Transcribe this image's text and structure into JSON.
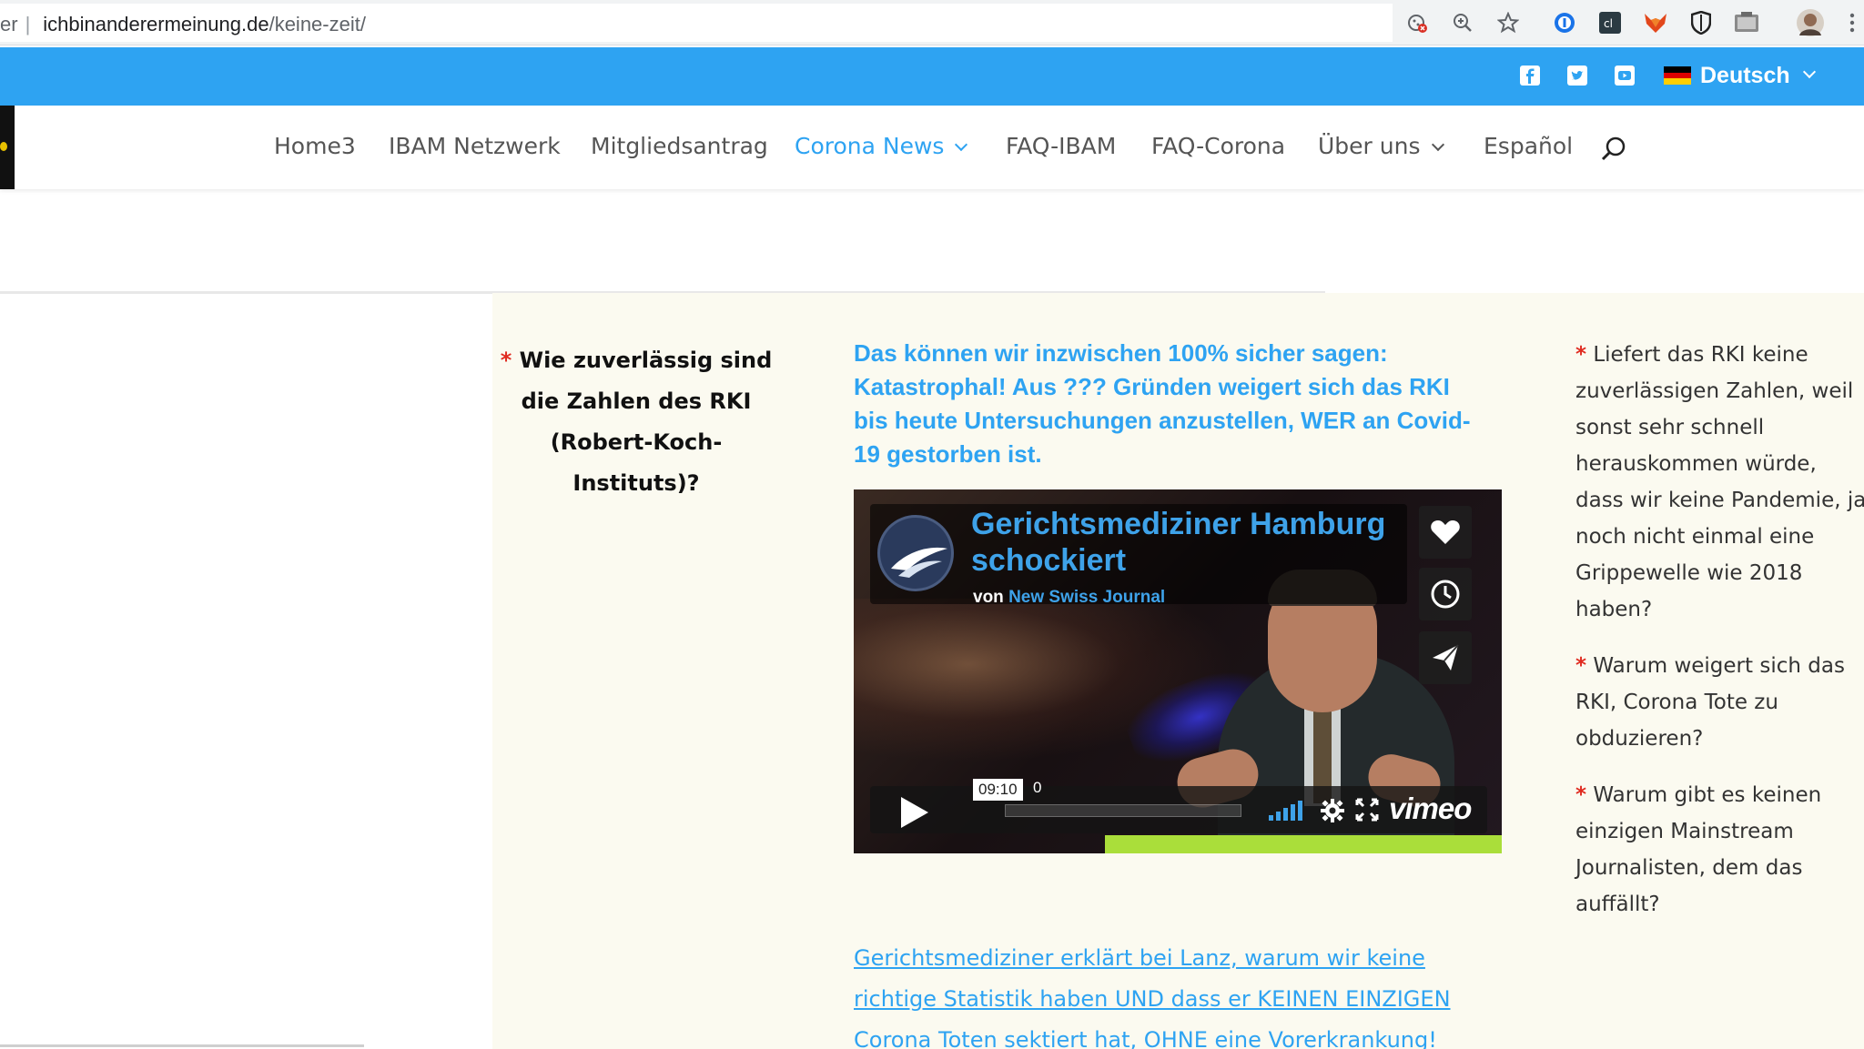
{
  "browser": {
    "prev_fragment": "er",
    "url_domain": "ichbinanderermeinung.de",
    "url_path": "/keine-zeit/"
  },
  "topbar": {
    "language": "Deutsch",
    "social_icons": [
      "facebook-icon",
      "twitter-icon",
      "youtube-icon"
    ]
  },
  "nav": {
    "items": [
      {
        "label": "Home3"
      },
      {
        "label": "IBAM Netzwerk"
      },
      {
        "label": "Mitgliedsantrag"
      },
      {
        "label": "Corona News",
        "active": true,
        "dropdown": true
      },
      {
        "label": "FAQ-IBAM"
      },
      {
        "label": "FAQ-Corona"
      },
      {
        "label": "Über uns",
        "dropdown": true
      },
      {
        "label": "Español"
      }
    ]
  },
  "left_question": {
    "asterisk": "*",
    "text": "Wie zuverlässig sind die Zahlen des RKI (Robert-Koch-Instituts)?"
  },
  "main": {
    "headline": "Das können wir inzwischen 100% sicher sagen: Katastrophal! Aus ??? Gründen weigert sich das RKI bis heute Untersuchungen anzustellen, WER an Covid-19 gestorben ist.",
    "video": {
      "title": "Gerichtsmediziner Hamburg schockiert",
      "by_prefix": "von",
      "channel": "New Swiss Journal",
      "time_tooltip": "09:10",
      "time_extra": "0",
      "provider": "vimeo"
    },
    "link": "Gerichtsmediziner erklärt bei Lanz, warum wir keine richtige Statistik haben UND dass er KEINEN EINZIGEN Corona Toten sektiert hat, OHNE eine Vorerkrankung!"
  },
  "right_questions": [
    {
      "asterisk": "*",
      "text": "Liefert das RKI keine zuverlässigen Zahlen, weil sonst sehr schnell herauskommen würde, dass wir keine Pandemie, ja noch nicht einmal eine Grippewelle wie 2018 haben?"
    },
    {
      "asterisk": "*",
      "text": "Warum weigert sich das RKI, Corona Tote zu obduzieren?"
    },
    {
      "asterisk": "*",
      "text": "Warum gibt es keinen einzigen Mainstream Journalisten, dem das auffällt?"
    }
  ],
  "colors": {
    "accent": "#2ea3f2",
    "asterisk": "#e02b20",
    "content_bg": "#fbfaf0",
    "vimeo_blue": "#3ea2e9"
  }
}
